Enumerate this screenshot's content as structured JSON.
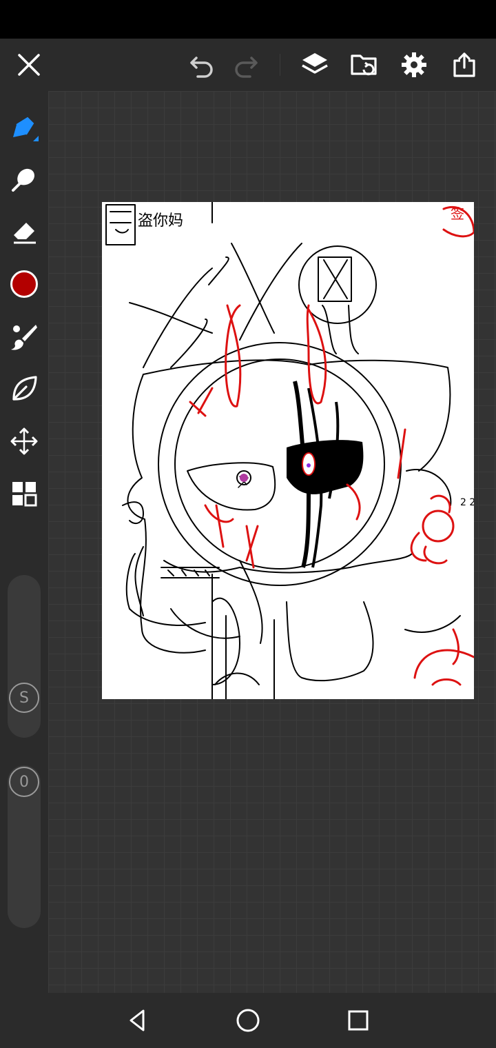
{
  "app": {
    "top_toolbar": [
      "close-icon",
      "undo-icon",
      "redo-icon",
      "layers-icon",
      "import-folder-icon",
      "settings-icon",
      "share-icon"
    ],
    "tools": [
      "pen-icon",
      "smudge-icon",
      "eraser-icon",
      "color-swatch",
      "brush-icon",
      "leaf-icon",
      "move-icon",
      "gallery-grid-icon"
    ],
    "active_tool": "pen-icon",
    "current_color": "#b30000",
    "accent_color": "#1e8fff",
    "size_slider_label": "S",
    "opacity_slider_label": "0"
  },
  "canvas": {
    "background": "#ffffff",
    "ink_color": "#000000",
    "accent_ink": "#dd1111",
    "stamp_text": "盗你妈",
    "corner_text": "签",
    "doodle_text": "2 2"
  },
  "navigation": [
    "back-icon",
    "home-icon",
    "recents-icon"
  ]
}
